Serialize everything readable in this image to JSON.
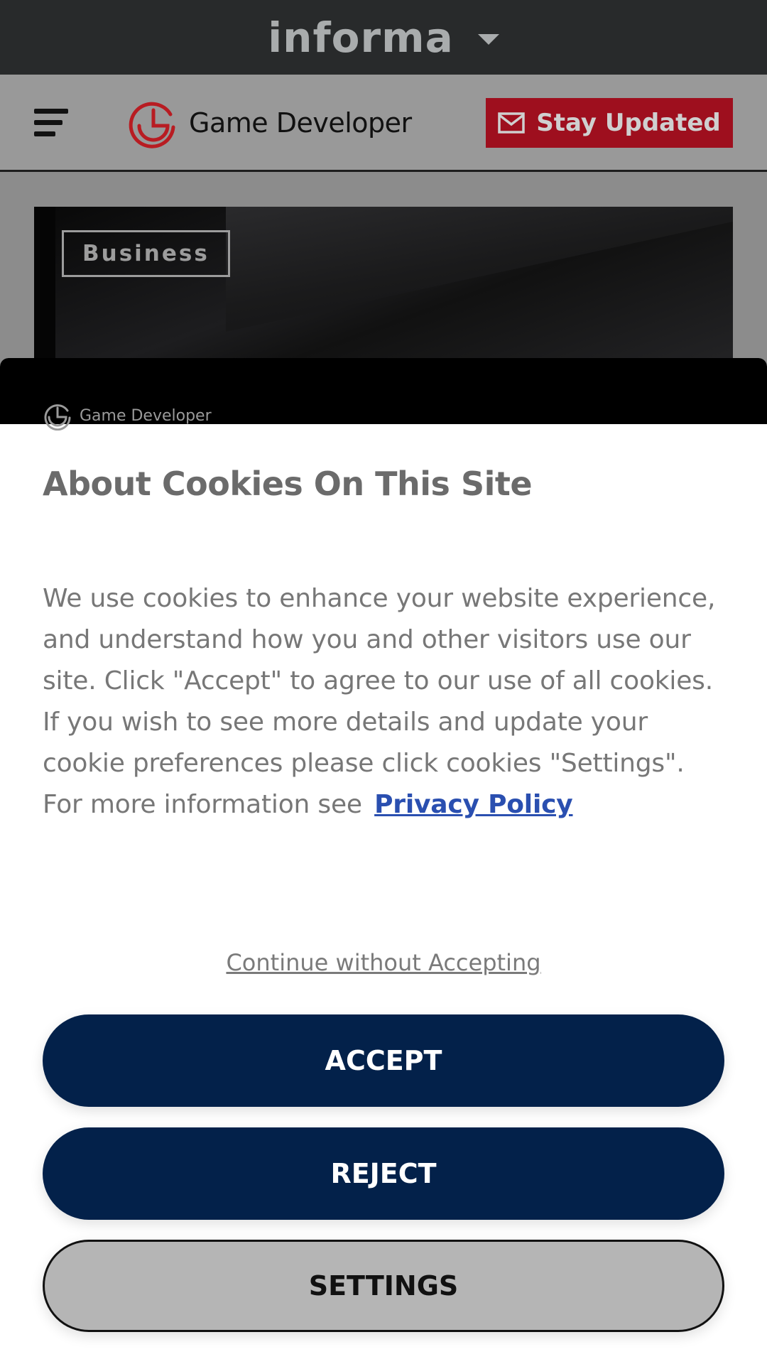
{
  "topbar": {
    "brand": "informa"
  },
  "header": {
    "logo_text": "Game Developer",
    "stay_updated": "Stay Updated"
  },
  "hero": {
    "tag": "Business"
  },
  "cookie_modal": {
    "logo_text": "Game Developer",
    "title": "About Cookies On This Site",
    "body": "We use cookies to enhance your website experience, and understand how you and other visitors use our site. Click \"Accept\" to agree to our use of all cookies. If you wish to see more details and update your cookie preferences please click cookies \"Settings\". For more information see",
    "privacy_link": "Privacy Policy",
    "continue_link": "Continue without Accepting",
    "accept": "ACCEPT",
    "reject": "REJECT",
    "settings": "SETTINGS"
  },
  "colors": {
    "accent_red": "#9e0f1e",
    "button_navy": "#03214a",
    "link_blue": "#2a4fb0"
  }
}
